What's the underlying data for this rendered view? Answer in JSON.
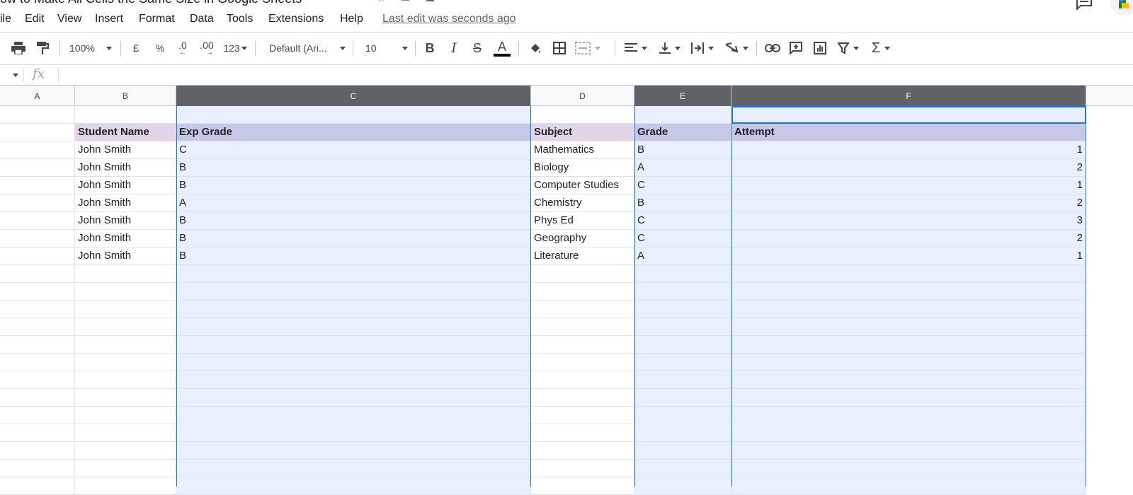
{
  "document": {
    "title": "ow to Make All Cells the Same Size in Google Sheets",
    "last_edit": "Last edit was seconds ago"
  },
  "menu": [
    "ile",
    "Edit",
    "View",
    "Insert",
    "Format",
    "Data",
    "Tools",
    "Extensions",
    "Help"
  ],
  "toolbar": {
    "zoom": "100%",
    "currency": "£",
    "percent": "%",
    "decrease_decimal": ".0",
    "increase_decimal": ".00",
    "number_format": "123",
    "font": "Default (Ari...",
    "font_size": "10",
    "bold": "B",
    "italic": "I",
    "strikethrough": "S",
    "text_color_label": "A",
    "text_color": "#000000",
    "sum": "Σ"
  },
  "formula_bar": {
    "fx": "fx",
    "value": ""
  },
  "grid": {
    "columns": [
      "A",
      "B",
      "C",
      "D",
      "E",
      "F"
    ],
    "selected_columns": [
      "C",
      "E",
      "F"
    ],
    "active_cell": "F1",
    "header_row": {
      "student_name": "Student Name",
      "exp_grade": "Exp Grade",
      "subject": "Subject",
      "grade": "Grade",
      "attempt": "Attempt"
    },
    "rows": [
      {
        "student": "John Smith",
        "exp_grade": "C",
        "subject": "Mathematics",
        "grade": "B",
        "attempt": "1"
      },
      {
        "student": "John Smith",
        "exp_grade": "B",
        "subject": "Biology",
        "grade": "A",
        "attempt": "2"
      },
      {
        "student": "John Smith",
        "exp_grade": "B",
        "subject": "Computer Studies",
        "grade": "C",
        "attempt": "1"
      },
      {
        "student": "John Smith",
        "exp_grade": "A",
        "subject": "Chemistry",
        "grade": "B",
        "attempt": "2"
      },
      {
        "student": "John Smith",
        "exp_grade": "B",
        "subject": "Phys Ed",
        "grade": "C",
        "attempt": "3"
      },
      {
        "student": "John Smith",
        "exp_grade": "B",
        "subject": "Geography",
        "grade": "C",
        "attempt": "2"
      },
      {
        "student": "John Smith",
        "exp_grade": "B",
        "subject": "Literature",
        "grade": "A",
        "attempt": "1"
      }
    ]
  },
  "colors": {
    "selection_fill": "#e8f0fe",
    "selection_border": "#1a73e8",
    "header_purple": "#e1d5e7",
    "header_blue": "#c5c8e6",
    "selected_header": "#5f6368"
  }
}
